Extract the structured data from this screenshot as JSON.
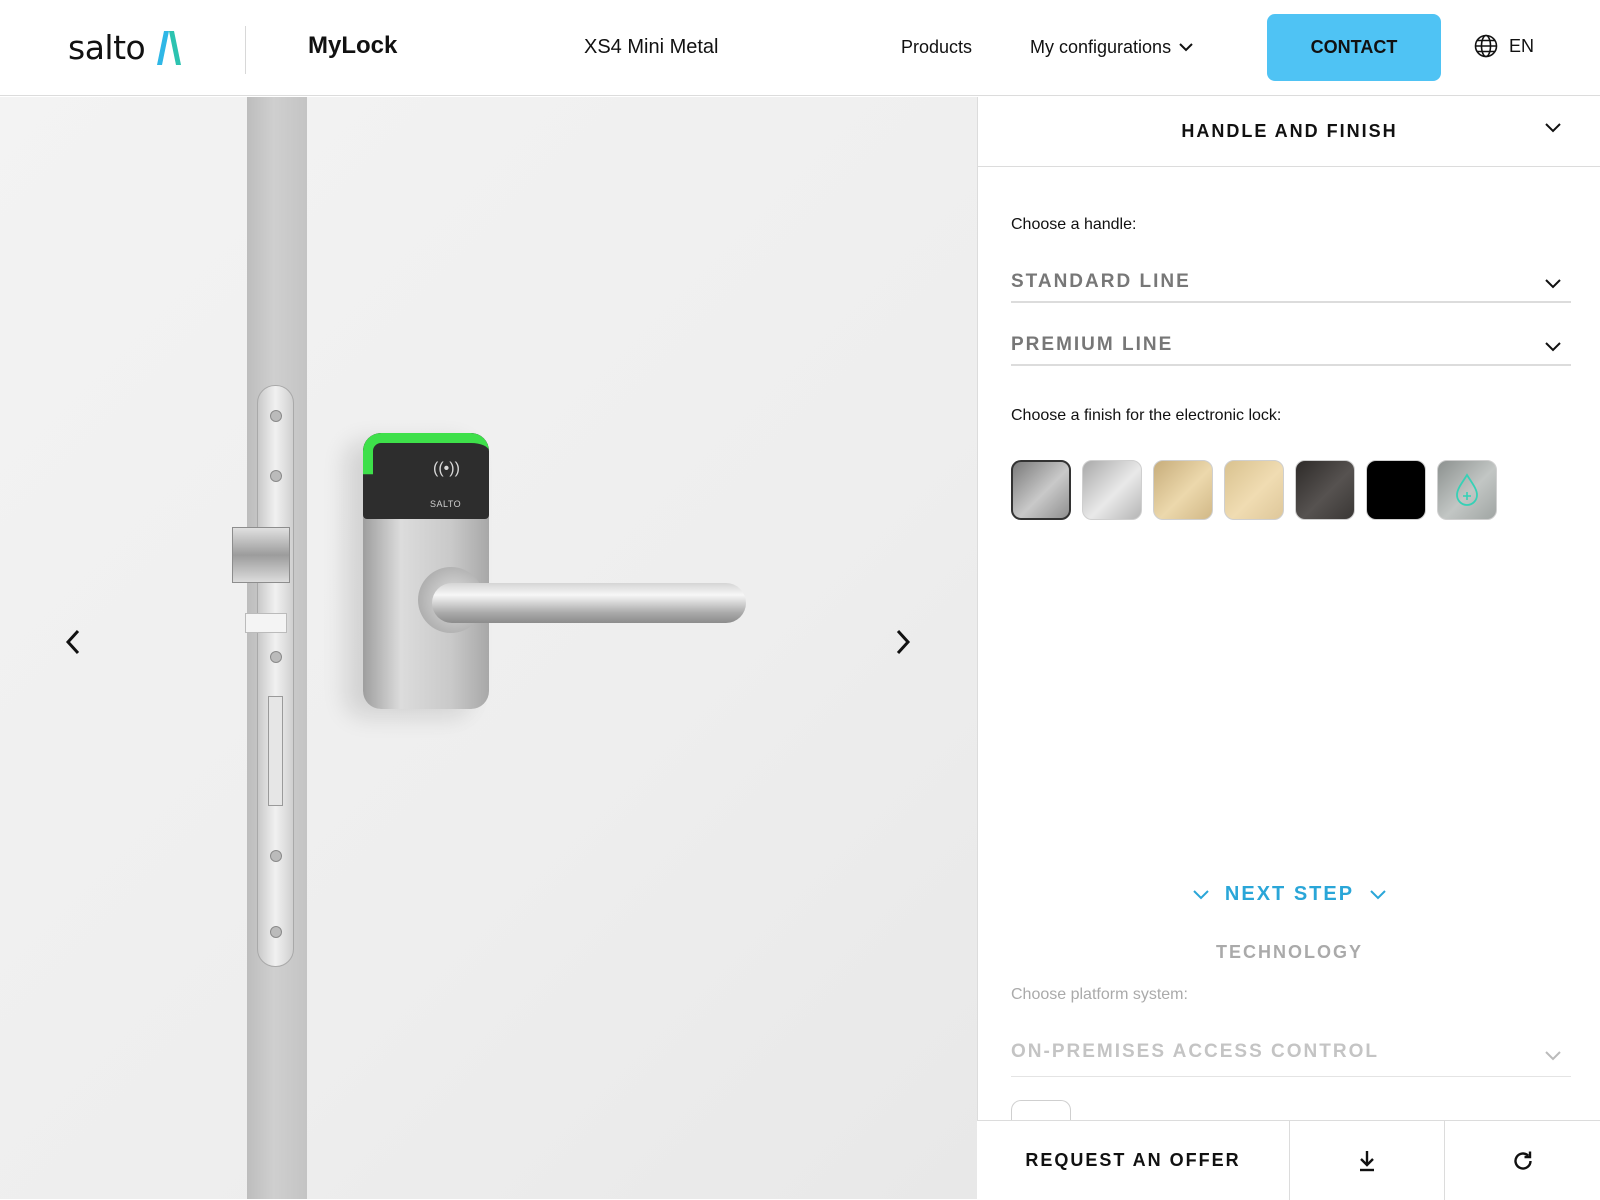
{
  "header": {
    "logo_text": "salto",
    "brand": "MyLock",
    "product_name": "XS4 Mini Metal",
    "nav": {
      "products": "Products",
      "configurations": "My configurations"
    },
    "contact_label": "CONTACT",
    "language": "EN",
    "accent_color": "#4fc3f4"
  },
  "viewer": {
    "lock_brand_mark": "SALTO",
    "led_color": "#3ee04a",
    "icons": [
      "chevron-left-icon",
      "chevron-right-icon"
    ]
  },
  "panel": {
    "section_title": "HANDLE AND FINISH",
    "handle_label": "Choose a handle:",
    "handle_options": [
      "STANDARD LINE",
      "PREMIUM LINE"
    ],
    "finish_label": "Choose a finish for the electronic lock:",
    "finishes": [
      {
        "color": "#a8a8a8",
        "selected": true
      },
      {
        "color": "#c6c6c6",
        "selected": false
      },
      {
        "color": "#dcc596",
        "selected": false
      },
      {
        "color": "#e4cd9e",
        "selected": false
      },
      {
        "color": "#413d3a",
        "selected": false
      },
      {
        "color": "#000000",
        "selected": false
      },
      {
        "color": "#9aa09d",
        "selected": false,
        "icon": "water-drop-plus-icon"
      }
    ],
    "next_step_label": "NEXT STEP",
    "next_section_title": "TECHNOLOGY",
    "platform_label": "Choose platform system:",
    "platform_value": "ON-PREMISES ACCESS CONTROL",
    "step_color": "#2aa6d8"
  },
  "bottom_bar": {
    "request_offer_label": "REQUEST AN OFFER",
    "icons": [
      "download-icon",
      "reset-icon"
    ]
  }
}
